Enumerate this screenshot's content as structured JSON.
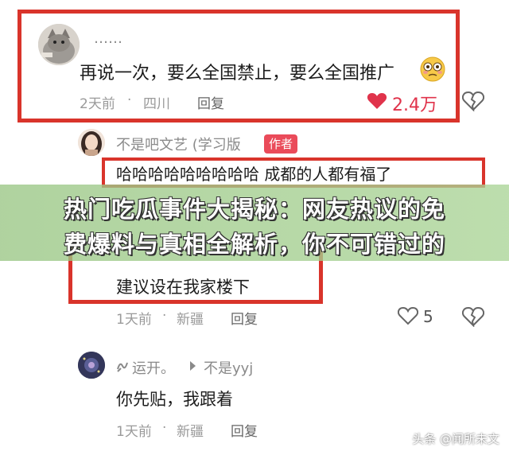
{
  "comments": [
    {
      "user": "……",
      "text": "再说一次，要么全国禁止，要么全国推广",
      "emoji": "flushed-face-emoji",
      "time": "2天前",
      "location": "四川",
      "reply": "回复",
      "likes": "2.4万",
      "liked": true
    },
    {
      "user": "不是吧文艺 (学习版",
      "badge": "作者",
      "text": "哈哈哈哈哈哈哈哈哈  成都的人都有福了"
    },
    {
      "text": "建议设在我家楼下",
      "time": "1天前",
      "location": "新疆",
      "reply": "回复",
      "likes": "5"
    },
    {
      "user": "运开。",
      "reply_to": "不是yyj",
      "text": "你先贴，我跟着",
      "time": "1天前",
      "location": "新疆",
      "reply": "回复"
    }
  ],
  "banner": {
    "line1": "热门吃瓜事件大揭秘：网友热议的免",
    "line2": "费爆料与真相全解析，你不可错过的"
  },
  "watermark": "头条 @闻所未文",
  "colors": {
    "highlight_border": "#d9342b",
    "like_red": "#e0334b",
    "badge": "#ea4b5a"
  }
}
